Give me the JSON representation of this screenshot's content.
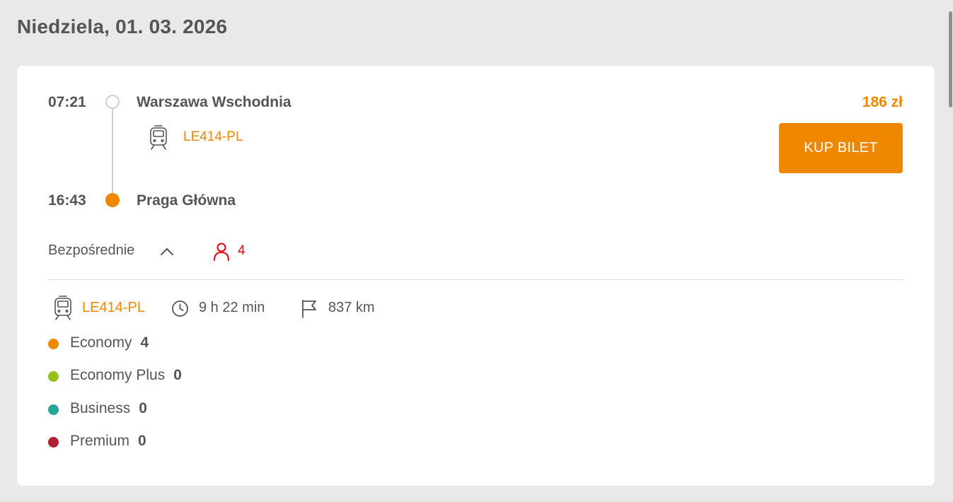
{
  "date_heading": "Niedziela, 01. 03. 2026",
  "journey": {
    "departure": {
      "time": "07:21",
      "station": "Warszawa Wschodnia"
    },
    "arrival": {
      "time": "16:43",
      "station": "Praga Główna"
    },
    "train_number": "LE414-PL",
    "price": "186 zł",
    "buy_label": "KUP BILET",
    "connection_type": "Bezpośrednie",
    "passengers": "4"
  },
  "details": {
    "train_number": "LE414-PL",
    "duration": "9 h 22 min",
    "distance": "837 km",
    "classes": [
      {
        "name": "Economy",
        "count": "4",
        "color": "#f08700"
      },
      {
        "name": "Economy Plus",
        "count": "0",
        "color": "#95c11f"
      },
      {
        "name": "Business",
        "count": "0",
        "color": "#26a69a"
      },
      {
        "name": "Premium",
        "count": "0",
        "color": "#b0202e"
      }
    ]
  },
  "colors": {
    "accent": "#f08700",
    "passenger_red": "#e2000f",
    "text": "#555555",
    "background": "#e9e9e9"
  },
  "icons": [
    "train-icon",
    "chevron-up-icon",
    "person-icon",
    "clock-icon",
    "flag-icon"
  ]
}
